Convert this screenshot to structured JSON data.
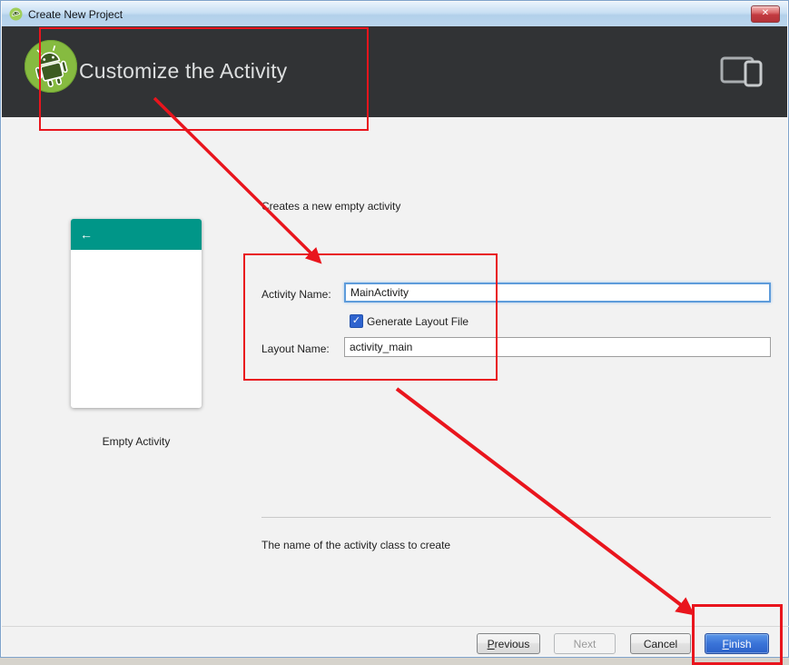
{
  "window": {
    "title": "Create New Project",
    "close_glyph": "✕"
  },
  "header": {
    "title": "Customize the Activity"
  },
  "preview": {
    "back_arrow": "←",
    "caption": "Empty Activity"
  },
  "form": {
    "description": "Creates a new empty activity",
    "activity_name": {
      "label": "Activity Name:",
      "value": "MainActivity"
    },
    "generate_layout": {
      "label": "Generate Layout File",
      "checked": true,
      "check_glyph": "✓"
    },
    "layout_name": {
      "label": "Layout Name:",
      "value": "activity_main"
    },
    "hint": "The name of the activity class to create"
  },
  "buttons": {
    "previous": {
      "initial": "P",
      "rest": "revious"
    },
    "next": {
      "label": "Next",
      "disabled": true
    },
    "cancel": {
      "label": "Cancel"
    },
    "finish": {
      "initial": "F",
      "rest": "inish"
    }
  },
  "colors": {
    "header_bg": "#313335",
    "toolbar_teal": "#009688",
    "annotation_red": "#E9151D",
    "finish_blue": "#3A73D8",
    "focus_border": "#5E9CDB",
    "titlebar_blue": "#BBD6EE"
  }
}
